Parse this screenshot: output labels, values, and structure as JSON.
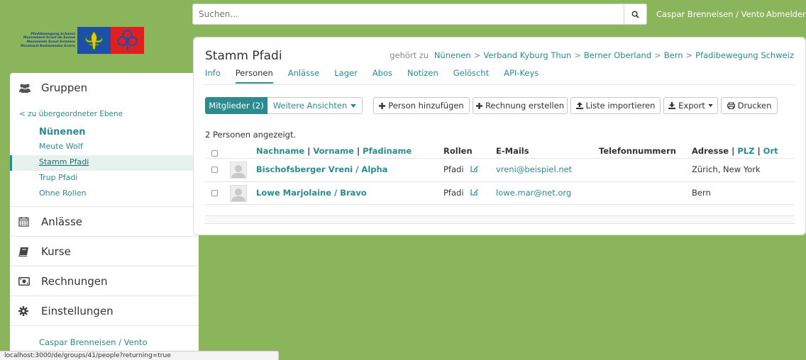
{
  "logo": {
    "lines": [
      "Pfadibewegung Schweiz",
      "Mouvement Scout de Suisse",
      "Movimento Scout Svizzero",
      "Moviment Battasendas Svizra"
    ]
  },
  "search": {
    "placeholder": "Suchen..."
  },
  "header": {
    "user": "Caspar Brenneisen / Vento",
    "logout": "Abmelden"
  },
  "sidebar": {
    "groups_label": "Gruppen",
    "up_link": "< zu übergeordneter Ebene",
    "layer": "Nünenen",
    "items": [
      {
        "label": "Meute Wolf",
        "active": false
      },
      {
        "label": "Stamm Pfadi",
        "active": true
      },
      {
        "label": "Trup Pfadi",
        "active": false
      },
      {
        "label": "Ohne Rollen",
        "active": false
      }
    ],
    "events": "Anlässe",
    "courses": "Kurse",
    "invoices": "Rechnungen",
    "settings": "Einstellungen",
    "footer_user": "Caspar Brenneisen / Vento"
  },
  "main": {
    "title": "Stamm Pfadi",
    "breadcrumb_prefix": "gehört zu",
    "breadcrumb": [
      "Nünenen",
      "Verband Kyburg Thun",
      "Berner Oberland",
      "Bern",
      "Pfadibewegung Schweiz"
    ],
    "tabs": [
      {
        "label": "Info",
        "active": false
      },
      {
        "label": "Personen",
        "active": true
      },
      {
        "label": "Anlässe",
        "active": false
      },
      {
        "label": "Lager",
        "active": false
      },
      {
        "label": "Abos",
        "active": false
      },
      {
        "label": "Notizen",
        "active": false
      },
      {
        "label": "Gelöscht",
        "active": false
      },
      {
        "label": "API-Keys",
        "active": false
      }
    ],
    "toolbar": {
      "members": "Mitglieder (2)",
      "views": "Weitere Ansichten",
      "add_person": "Person hinzufügen",
      "create_invoice": "Rechnung erstellen",
      "import_list": "Liste importieren",
      "export": "Export",
      "print": "Drucken"
    },
    "count_text": "2 Personen angezeigt."
  },
  "table": {
    "headers": {
      "lastname": "Nachname",
      "firstname": "Vorname",
      "nickname": "Pfadiname",
      "sep": "|",
      "roles": "Rollen",
      "emails": "E-Mails",
      "phones": "Telefonnummern",
      "address": "Adresse",
      "zip": "PLZ",
      "town": "Ort"
    },
    "rows": [
      {
        "name": "Bischofsberger Vreni / Alpha",
        "role": "Pfadi",
        "email": "vreni@beispiel.net",
        "address": "Zürich, New York"
      },
      {
        "name": "Lowe Marjolaine / Bravo",
        "role": "Pfadi",
        "email": "lowe.mar@net.org",
        "address": "Bern"
      }
    ]
  },
  "status_url": "localhost:3000/de/groups/41/people?returning=true",
  "colors": {
    "accent": "#2b8b8f",
    "background": "#8bb55b",
    "flag_blue": "#1d4fa8",
    "flag_red": "#e02020"
  }
}
